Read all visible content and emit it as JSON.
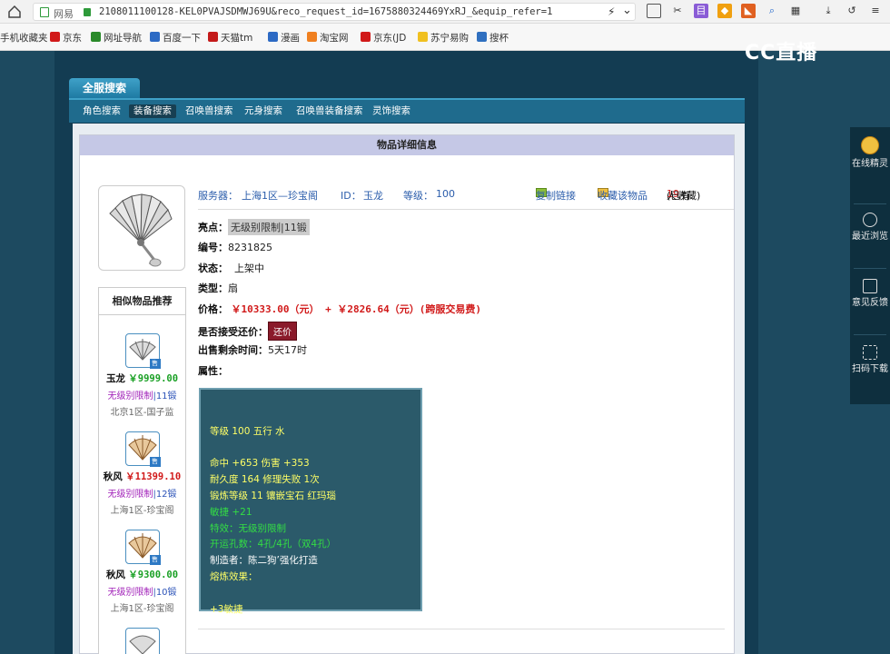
{
  "browser": {
    "site_name": "网易",
    "url": "2108011100128-KEL0PVAJSDMWJ69U&reco_request_id=1675880324469YxRJ_&equip_refer=1",
    "bookmarks": [
      "手机收藏夹",
      "京东",
      "网址导航",
      "百度一下",
      "天猫tm",
      "漫画",
      "淘宝网",
      "京东(JD",
      "苏宁易购",
      "搜杯"
    ]
  },
  "logo_text": "CC直播",
  "tabs": {
    "main": "全服搜索",
    "sub": [
      "角色搜索",
      "装备搜索",
      "召唤兽搜索",
      "元身搜索",
      "召唤兽装备搜索",
      "灵饰搜索"
    ],
    "active_index": 1
  },
  "panel": {
    "title": "物品详细信息"
  },
  "item": {
    "server_label": "服务器：",
    "server": "上海1区—珍宝阁",
    "id_label": "ID：",
    "id": "玉龙",
    "level_label": "等级：",
    "level": "100",
    "copy_link": "复制链接",
    "favorite": "收藏该物品",
    "fav_prefix": "(已有",
    "fav_count": "19",
    "fav_suffix": "人收藏)",
    "highlight_label": "亮点：",
    "highlight": "无级别限制|11锻",
    "serial_label": "编号：",
    "serial": "8231825",
    "status_label": "状态：",
    "status": "上架中",
    "type_label": "类型：",
    "type": "扇",
    "price_label": "价格：",
    "price": "￥10333.00（元） + ￥2826.64（元）(跨服交易费)",
    "counter_label": "是否接受还价：",
    "counter_btn": "还价",
    "remain_label": "出售剩余时间：",
    "remain": "5天17时",
    "attr_label": "属性：",
    "attributes": [
      {
        "text": "",
        "color": "#ffff66"
      },
      {
        "text": "等级 100 五行 水",
        "color": "#ffff66"
      },
      {
        "text": "",
        "color": "#ffff66"
      },
      {
        "text": "命中 +653 伤害 +353",
        "color": "#ffff66"
      },
      {
        "text": "耐久度 164 修理失败 1次",
        "color": "#ffff66"
      },
      {
        "text": "锻炼等级 11 镶嵌宝石 红玛瑙",
        "color": "#ffff66"
      },
      {
        "text": "敏捷 +21",
        "color": "#33dd44"
      },
      {
        "text": "特效：无级别限制",
        "color": "#33dd44"
      },
      {
        "text": "开运孔数：4孔/4孔（双4孔）",
        "color": "#33dd44"
      },
      {
        "text": "制造者：陈二狗’强化打造",
        "color": "#ffffff"
      },
      {
        "text": "熔炼效果：",
        "color": "#ffff66"
      },
      {
        "text": "",
        "color": "#ffff66"
      },
      {
        "text": "+3敏捷",
        "color": "#ffff66"
      }
    ]
  },
  "recommend": {
    "title": "相似物品推荐",
    "items": [
      {
        "name": "玉龙",
        "price": "￥9999.00",
        "limit": "无级别限制",
        "lv": "|11锻",
        "server": "北京1区-国子监",
        "price_color": "green"
      },
      {
        "name": "秋风",
        "price": "￥11399.10",
        "limit": "无级别限制",
        "lv": "|12锻",
        "server": "上海1区-珍宝阁",
        "price_color": "red"
      },
      {
        "name": "秋风",
        "price": "￥9300.00",
        "limit": "无级别限制",
        "lv": "|10锻",
        "server": "上海1区-珍宝阁",
        "price_color": "green"
      }
    ]
  },
  "right_sidebar": [
    {
      "label": "在线精灵"
    },
    {
      "label": "最近浏览"
    },
    {
      "label": "意见反馈"
    },
    {
      "label": "扫码下载"
    }
  ]
}
